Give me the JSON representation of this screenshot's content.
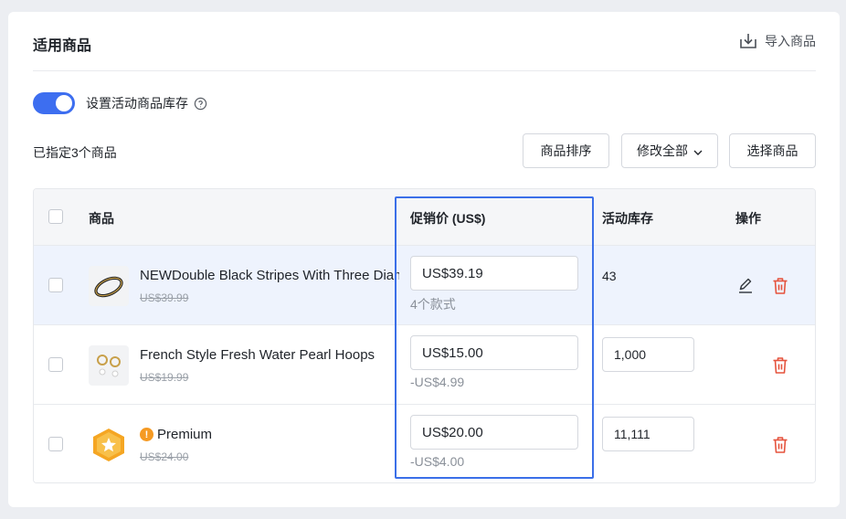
{
  "header": {
    "title": "适用商品",
    "import_label": "导入商品",
    "import_icon": "import-icon"
  },
  "toggle": {
    "label": "设置活动商品库存",
    "checked": true,
    "accent": "#3d6ef0",
    "help_icon": "question-circle-icon"
  },
  "toolbar": {
    "count_label": "已指定3个商品",
    "sort_label": "商品排序",
    "edit_all_label": "修改全部",
    "select_label": "选择商品"
  },
  "table": {
    "columns": [
      "商品",
      "促销价 (US$)",
      "活动库存",
      "操作"
    ],
    "rows": [
      {
        "name": "NEWDouble Black Stripes With Three Diamonds",
        "original_price": "US$39.99",
        "promo_price": "US$39.19",
        "sub_text": "4个款式",
        "stock": "43",
        "stock_editable": false,
        "has_edit": true,
        "highlighted": true
      },
      {
        "name": "French Style Fresh Water Pearl Hoops",
        "original_price": "US$19.99",
        "promo_price": "US$15.00",
        "sub_text": "-US$4.99",
        "stock": "1,000",
        "stock_editable": true,
        "has_edit": false,
        "highlighted": false
      },
      {
        "name": "Premium",
        "original_price": "US$24.00",
        "promo_price": "US$20.00",
        "sub_text": "-US$4.00",
        "stock": "11,111",
        "stock_editable": true,
        "has_edit": false,
        "highlighted": false,
        "warning_glyph": "!"
      }
    ]
  },
  "colors": {
    "accent": "#3d6ef0",
    "delete": "#e5533d",
    "highlight_border": "#3b6fe8",
    "warning": "#f59a23"
  }
}
